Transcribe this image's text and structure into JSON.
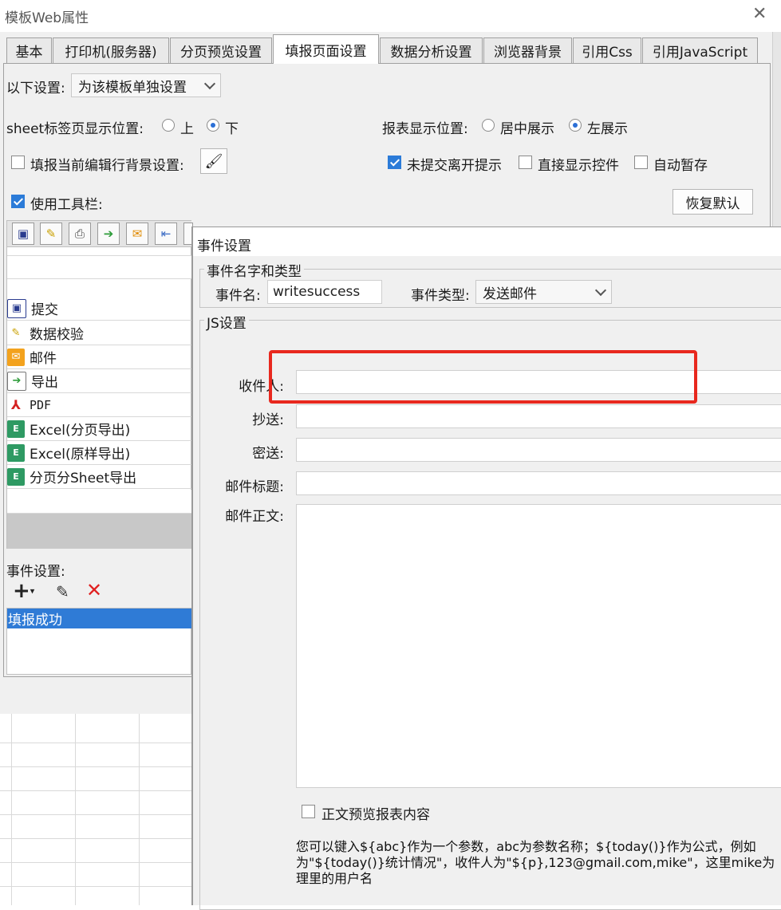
{
  "window": {
    "title": "模板Web属性"
  },
  "tabs": [
    {
      "label": "基本"
    },
    {
      "label": "打印机(服务器)"
    },
    {
      "label": "分页预览设置"
    },
    {
      "label": "填报页面设置"
    },
    {
      "label": "数据分析设置"
    },
    {
      "label": "浏览器背景"
    },
    {
      "label": "引用Css"
    },
    {
      "label": "引用JavaScript"
    }
  ],
  "settings": {
    "scope_label": "以下设置:",
    "scope_value": "为该模板单独设置",
    "sheet_pos_label": "sheet标签页显示位置:",
    "sheet_top": "上",
    "sheet_bottom": "下",
    "report_pos_label": "报表显示位置:",
    "center": "居中展示",
    "left": "左展示",
    "row_bg_label": "填报当前编辑行背景设置:",
    "leave_prompt": "未提交离开提示",
    "show_widget": "直接显示控件",
    "auto_save": "自动暂存",
    "use_toolbar": "使用工具栏:",
    "restore_default": "恢复默认"
  },
  "toolbar_items": [
    {
      "label": "提交",
      "icon": "save-icon"
    },
    {
      "label": "数据校验",
      "icon": "pencil-check-icon"
    },
    {
      "label": "邮件",
      "icon": "mail-icon"
    },
    {
      "label": "导出",
      "icon": "export-icon"
    },
    {
      "label": "PDF",
      "icon": "pdf-icon"
    },
    {
      "label": "Excel(分页导出)",
      "icon": "excel-icon"
    },
    {
      "label": "Excel(原样导出)",
      "icon": "excel-icon"
    },
    {
      "label": "分页分Sheet导出",
      "icon": "excel-icon"
    }
  ],
  "events": {
    "label": "事件设置:",
    "items": [
      "填报成功"
    ]
  },
  "event_dialog": {
    "title": "事件设置",
    "group_name_type": "事件名字和类型",
    "name_label": "事件名:",
    "name_value": "writesuccess",
    "type_label": "事件类型:",
    "type_value": "发送邮件",
    "group_js": "JS设置",
    "to_label": "收件人:",
    "cc_label": "抄送:",
    "bcc_label": "密送:",
    "subject_label": "邮件标题:",
    "body_label": "邮件正文:",
    "preview_label": "正文预览报表内容",
    "help_line1": "您可以键入${abc}作为一个参数，abc为参数名称；${today()}作为公式，例如",
    "help_line2": "为\"${today()}统计情况\"，收件人为\"${p},123@gmail.com,mike\"，这里mike为",
    "help_line3": "理里的用户名"
  },
  "colors": {
    "highlight": "#e8281e",
    "selection": "#2f7bd6",
    "accent": "#2b7bd8"
  }
}
